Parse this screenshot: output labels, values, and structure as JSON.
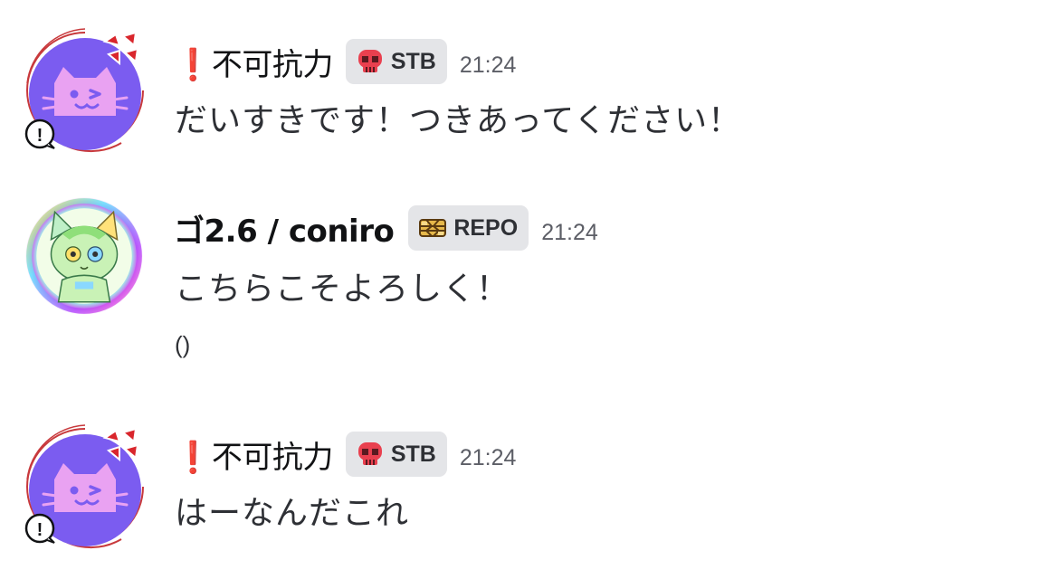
{
  "messages": [
    {
      "author": "❗不可抗力",
      "tag": {
        "label": "STB",
        "icon": "pink-skull-icon"
      },
      "time": "21:24",
      "lines": [
        "だいすきです！つきあってください！"
      ],
      "avatar": "purple-cat-avatar"
    },
    {
      "author": "ゴ2.6 / coniro",
      "tag": {
        "label": "REPO",
        "icon": "gold-knot-icon"
      },
      "time": "21:24",
      "lines": [
        "こちらこそよろしく！",
        "()"
      ],
      "avatar": "green-anime-cat-avatar"
    },
    {
      "author": "❗不可抗力",
      "tag": {
        "label": "STB",
        "icon": "pink-skull-icon"
      },
      "time": "21:24",
      "lines": [
        "はーなんだこれ"
      ],
      "avatar": "purple-cat-avatar"
    }
  ],
  "colors": {
    "avatar_purple": "#7b5cf0",
    "cat_pink": "#e9a2f2",
    "anger_red": "#d9262c",
    "tag_bg": "#e4e5e8",
    "timestamp": "#5c5e66",
    "text": "#2e3035"
  }
}
